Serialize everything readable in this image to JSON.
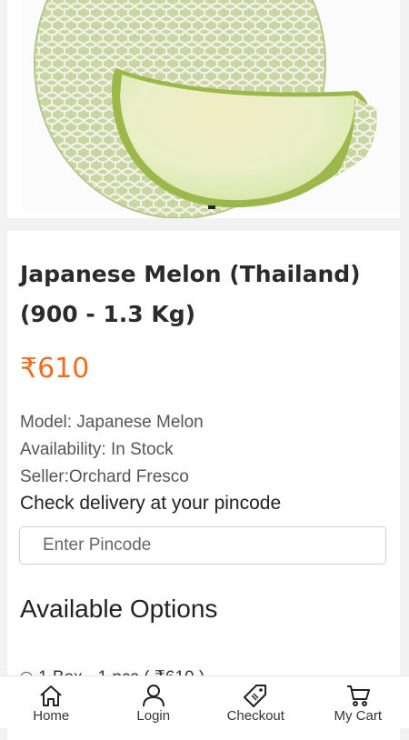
{
  "product": {
    "title": "Japanese Melon (Thailand) (900 - 1.3 Kg)",
    "price": "₹610",
    "model": "Model: Japanese Melon",
    "availability": "Availability: In Stock",
    "seller": "Seller:Orchard Fresco",
    "delivery_check": "Check delivery at your pincode",
    "pincode_placeholder": "Enter Pincode",
    "options_title": "Available Options",
    "option_label": "1 Box - 1 pcs ( ₹610 )"
  },
  "bottom_nav": {
    "items": [
      {
        "label": "Home",
        "icon": "home-icon"
      },
      {
        "label": "Login",
        "icon": "user-icon"
      },
      {
        "label": "Checkout",
        "icon": "price-tag-icon"
      },
      {
        "label": "My Cart",
        "icon": "cart-icon"
      }
    ]
  },
  "colors": {
    "price": "#f26c1e",
    "melon_skin": "#dfe6c8",
    "melon_flesh": "#eaf1c8"
  }
}
